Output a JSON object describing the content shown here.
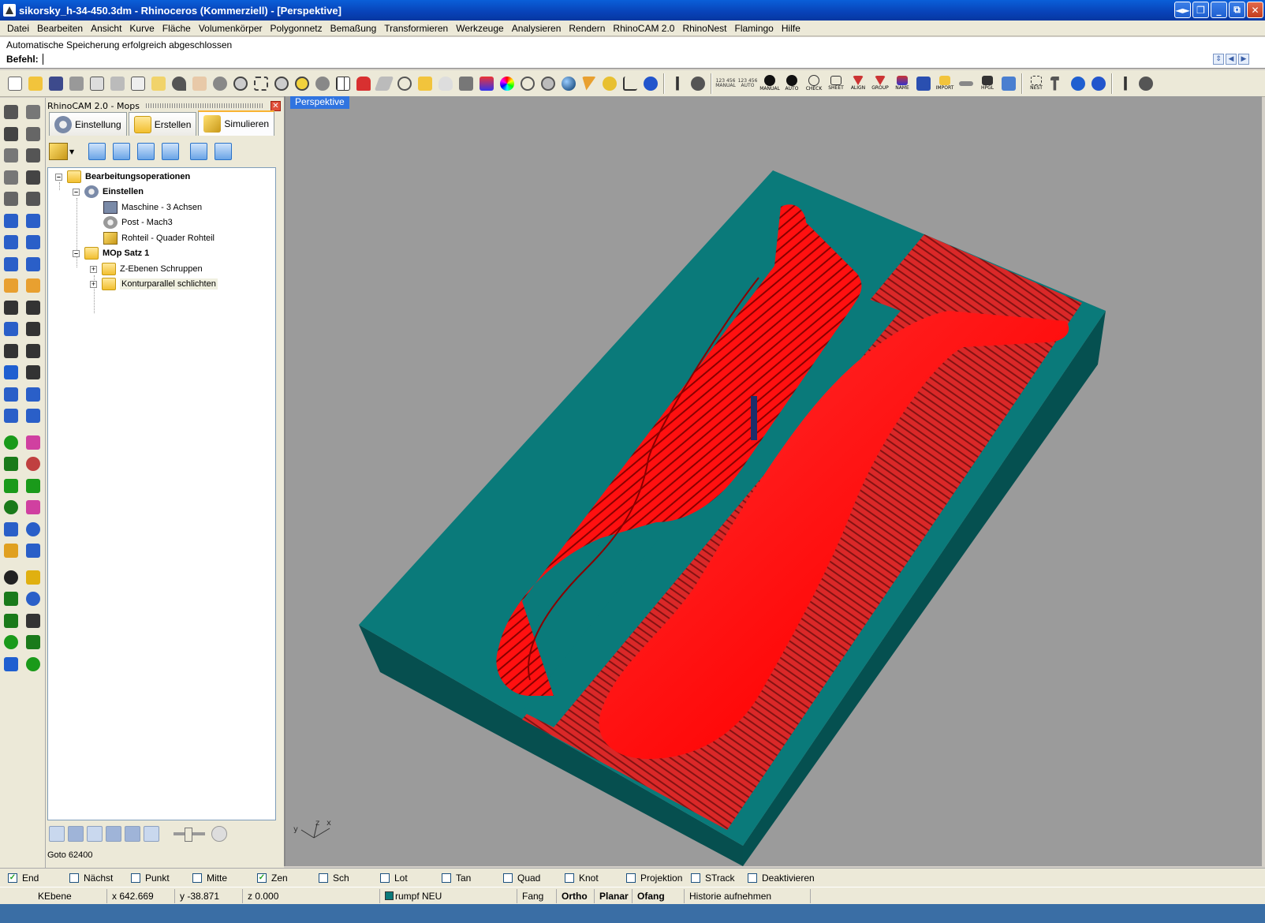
{
  "window": {
    "title": "sikorsky_h-34-450.3dm - Rhinoceros (Kommerziell) - [Perspektive]",
    "buttons": [
      "◄►",
      "❐",
      "_",
      "⧉",
      "✕"
    ]
  },
  "menu": [
    "Datei",
    "Bearbeiten",
    "Ansicht",
    "Kurve",
    "Fläche",
    "Volumenkörper",
    "Polygonnetz",
    "Bemaßung",
    "Transformieren",
    "Werkzeuge",
    "Analysieren",
    "Rendern",
    "RhinoCAM 2.0",
    "RhinoNest",
    "Flamingo",
    "Hilfe"
  ],
  "command": {
    "history": "Automatische Speicherung erfolgreich abgeschlossen",
    "prompt": "Befehl:",
    "value": ""
  },
  "toolbar": {
    "text_icons": [
      "123 456 MANUAL",
      "123 456 AUTO",
      "MANUAL",
      "AUTO",
      "CHECK",
      "SHEET",
      "ALIGN",
      "GROUP",
      "NAME",
      "IMPORT",
      "HPGL",
      "NEST"
    ]
  },
  "panel": {
    "title": "RhinoCAM 2.0 - Mops",
    "close": "✕",
    "tabs": [
      {
        "label": "Einstellung",
        "active": false
      },
      {
        "label": "Erstellen",
        "active": false
      },
      {
        "label": "Simulieren",
        "active": true
      }
    ],
    "tree": {
      "root": "Bearbeitungsoperationen",
      "setup": "Einstellen",
      "machine": "Maschine - 3 Achsen",
      "post": "Post - Mach3",
      "stock": "Rohteil - Quader Rohteil",
      "mopset": "MOp Satz 1",
      "op1": "Z-Ebenen Schruppen",
      "op2": "Konturparallel schlichten"
    },
    "goto": "Goto 62400"
  },
  "viewport": {
    "label": "Perspektive",
    "axes": {
      "x": "x",
      "y": "y",
      "z": "z"
    },
    "colors": {
      "background": "#9b9b9b",
      "stock": "#0a7a7a",
      "part": "#ff1a1a"
    }
  },
  "osnaps": [
    {
      "label": "End",
      "checked": true
    },
    {
      "label": "Nächst",
      "checked": false
    },
    {
      "label": "Punkt",
      "checked": false
    },
    {
      "label": "Mitte",
      "checked": false
    },
    {
      "label": "Zen",
      "checked": true
    },
    {
      "label": "Sch",
      "checked": false
    },
    {
      "label": "Lot",
      "checked": false
    },
    {
      "label": "Tan",
      "checked": false
    },
    {
      "label": "Quad",
      "checked": false
    },
    {
      "label": "Knot",
      "checked": false
    },
    {
      "label": "Projektion",
      "checked": false
    },
    {
      "label": "STrack",
      "checked": false
    },
    {
      "label": "Deaktivieren",
      "checked": false
    }
  ],
  "status": {
    "plane": "KEbene",
    "x": "x 642.669",
    "y": "y -38.871",
    "z": "z 0.000",
    "layer": "rumpf NEU",
    "layer_color": "#0a7a7a",
    "fang": "Fang",
    "ortho": "Ortho",
    "planar": "Planar",
    "ofang": "Ofang",
    "history": "Historie aufnehmen"
  }
}
